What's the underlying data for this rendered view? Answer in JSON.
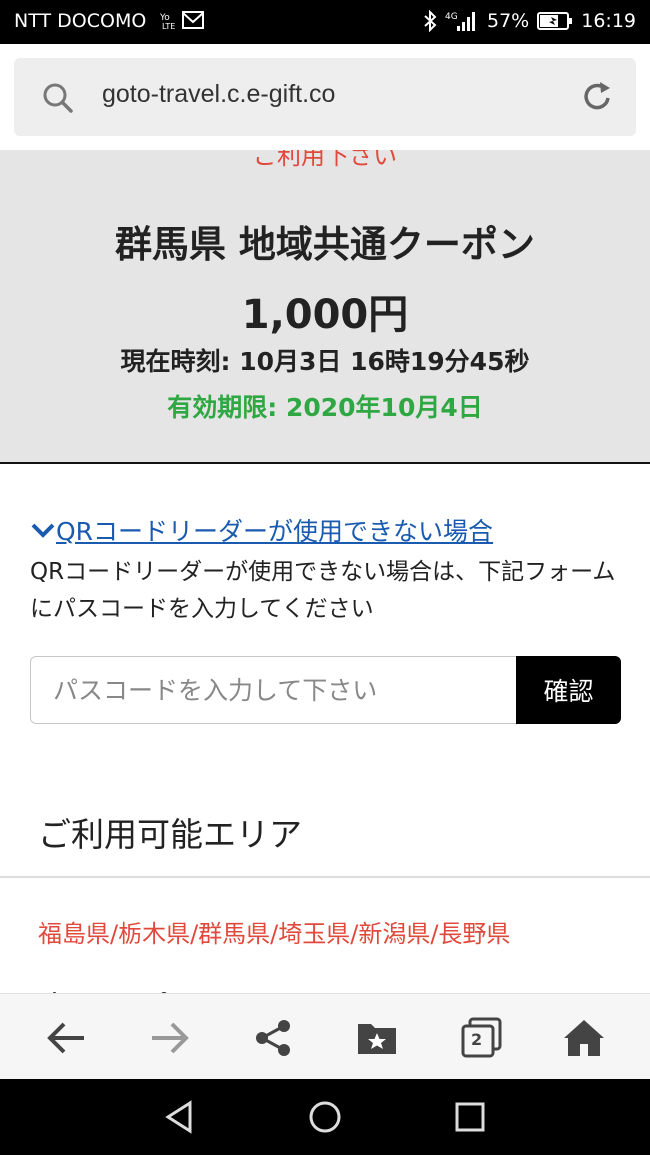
{
  "status_bar": {
    "carrier": "NTT DOCOMO",
    "battery": "57%",
    "time": "16:19"
  },
  "address_bar": {
    "url": "goto-travel.c.e-gift.co"
  },
  "coupon": {
    "cut_text": "ご利用下さい",
    "title": "群馬県 地域共通クーポン",
    "amount": "1,000円",
    "current_time": "現在時刻: 10月3日 16時19分45秒",
    "expiry": "有効期限: 2020年10月4日",
    "expiry_color": "#2fa843"
  },
  "qr_section": {
    "link_label": "QRコードリーダーが使用できない場合",
    "description": "QRコードリーダーが使用できない場合は、下記フォームにパスコードを入力してください",
    "passcode_placeholder": "パスコードを入力して下さい",
    "passcode_value": "",
    "confirm_label": "確認",
    "link_color": "#1a5bb0"
  },
  "area": {
    "heading": "ご利用可能エリア",
    "list": "福島県/栃木県/群馬県/埼玉県/新潟県/長野県",
    "next_heading_cut": "本クーポンについて",
    "list_color": "#e04a3c"
  },
  "toolbar": {
    "tab_count": "2",
    "icons": [
      "back-arrow-icon",
      "forward-arrow-icon",
      "share-icon",
      "bookmarks-icon",
      "tabs-icon",
      "home-icon"
    ]
  },
  "navbar": {
    "icons": [
      "back-triangle-icon",
      "home-circle-icon",
      "recents-square-icon"
    ]
  }
}
